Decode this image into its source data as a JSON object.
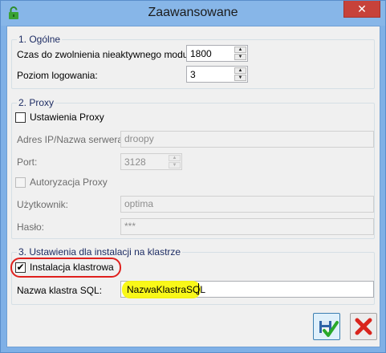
{
  "window": {
    "title": "Zaawansowane",
    "close_glyph": "✕"
  },
  "groups": {
    "general": {
      "title": "1. Ogólne",
      "idle_timeout": {
        "label": "Czas do zwolnienia nieaktywnego modułu:",
        "value": "1800"
      },
      "log_level": {
        "label": "Poziom logowania:",
        "value": "3"
      }
    },
    "proxy": {
      "title": "2. Proxy",
      "proxy_settings": {
        "label": "Ustawienia Proxy",
        "checked": false
      },
      "address": {
        "label": "Adres IP/Nazwa serwera:",
        "value": "droopy"
      },
      "port": {
        "label": "Port:",
        "value": "3128"
      },
      "auth": {
        "label": "Autoryzacja Proxy",
        "checked": false
      },
      "user": {
        "label": "Użytkownik:",
        "value": "optima"
      },
      "password": {
        "label": "Hasło:",
        "value": "***"
      }
    },
    "cluster": {
      "title": "3. Ustawienia dla instalacji na klastrze",
      "cluster_install": {
        "label": "Instalacja klastrowa",
        "checked": true,
        "check_glyph": "✔"
      },
      "cluster_name": {
        "label": "Nazwa klastra SQL:",
        "value": "NazwaKlastraSQL"
      }
    }
  },
  "icons": {
    "app": "lock-icon",
    "ok": "save-check-icon",
    "cancel": "cancel-x-icon"
  },
  "colors": {
    "title_bar": "#87b6e8",
    "highlight_circle": "#e0201d",
    "highlight_yellow": "#f8f700",
    "cancel_red": "#d9251d"
  }
}
